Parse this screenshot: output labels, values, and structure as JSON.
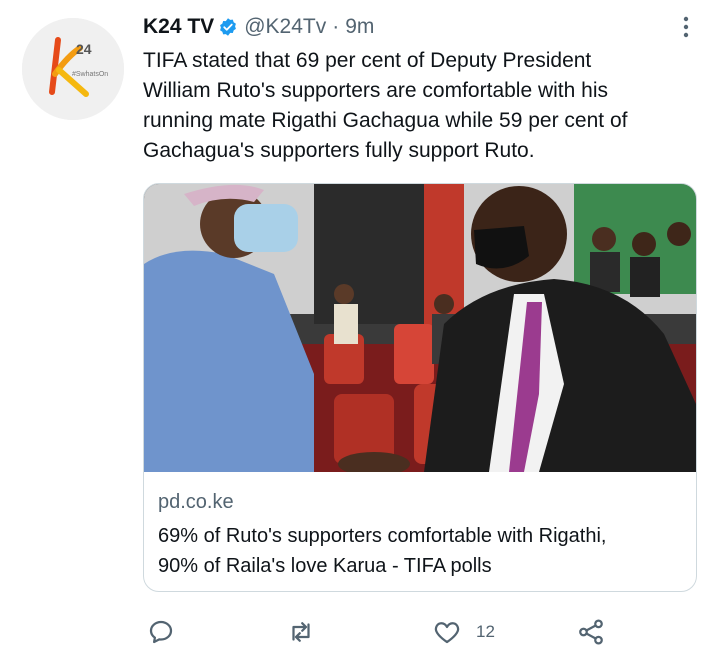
{
  "tweet": {
    "author_name": "K24 TV",
    "handle": "@K24Tv",
    "separator": "·",
    "time": "9m",
    "avatar_logo": {
      "text": "24",
      "subtext": "#SwhatsOn"
    },
    "text_lines": [
      "TIFA stated that 69 per cent of Deputy President",
      "William Ruto's supporters are comfortable with his",
      "running mate Rigathi Gachagua while 59 per cent of",
      "Gachagua's supporters fully support Ruto."
    ]
  },
  "card": {
    "domain": "pd.co.ke",
    "title_lines": [
      "69% of Ruto's supporters comfortable with Rigathi,",
      "90% of Raila's love Karua - TIFA polls"
    ]
  },
  "actions": {
    "likes_count": "12"
  },
  "icons": {
    "verified": "verified-badge-icon",
    "more": "more-options-icon",
    "reply": "reply-icon",
    "retweet": "retweet-icon",
    "like": "like-icon",
    "share": "share-icon"
  },
  "colors": {
    "verified": "#1d9bf0",
    "text": "#0f1419",
    "secondary": "#536471",
    "border": "#cfd9de",
    "logo_orange": "#f39c12",
    "logo_red": "#e64a19"
  }
}
